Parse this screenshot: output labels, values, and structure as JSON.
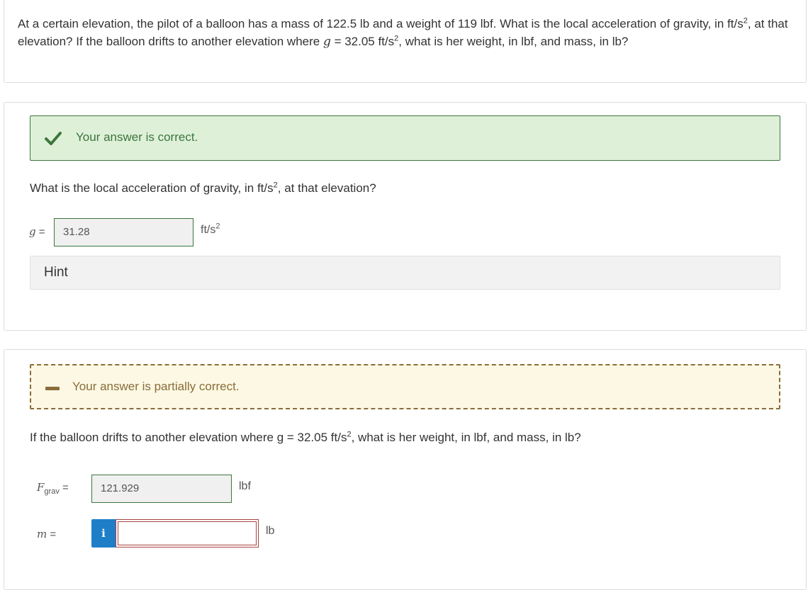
{
  "question": {
    "text_part1": "At a certain elevation, the pilot of a balloon has a mass of 122.5 lb and a weight of 119 lbf. What is the local acceleration of gravity, in ft/s",
    "sup1": "2",
    "text_part2": ", at that elevation? If the balloon drifts to another elevation where ",
    "g_var": "g",
    "text_part3": " = 32.05 ft/s",
    "sup2": "2",
    "text_part4": ", what is her weight, in lbf, and mass, in lb?"
  },
  "part1": {
    "feedback": "Your answer is correct.",
    "feedback_color": "#3c763d",
    "question_pre": "What is the local acceleration of gravity, in ft/s",
    "question_sup": "2",
    "question_post": ", at that elevation?",
    "var": "g",
    "equals": "=",
    "answer": "31.28",
    "unit_base": "ft/s",
    "unit_sup": "2",
    "hint_label": "Hint"
  },
  "part2": {
    "feedback": "Your answer is partially correct.",
    "feedback_color": "#8a6d3b",
    "question_pre": "If the balloon drifts to another elevation where g = 32.05 ft/s",
    "question_sup": "2",
    "question_post": ", what is her weight, in lbf, and mass, in lb?",
    "fgrav_var": "F",
    "fgrav_sub": "grav",
    "fgrav_equals": "=",
    "fgrav_answer": "121.929",
    "fgrav_unit": "lbf",
    "m_var": "m",
    "m_equals": "=",
    "m_answer": "",
    "m_unit": "lb",
    "info_icon": "i"
  },
  "icons": {
    "correct": "checkmark-icon",
    "partial": "dash-icon",
    "info": "info-icon"
  }
}
